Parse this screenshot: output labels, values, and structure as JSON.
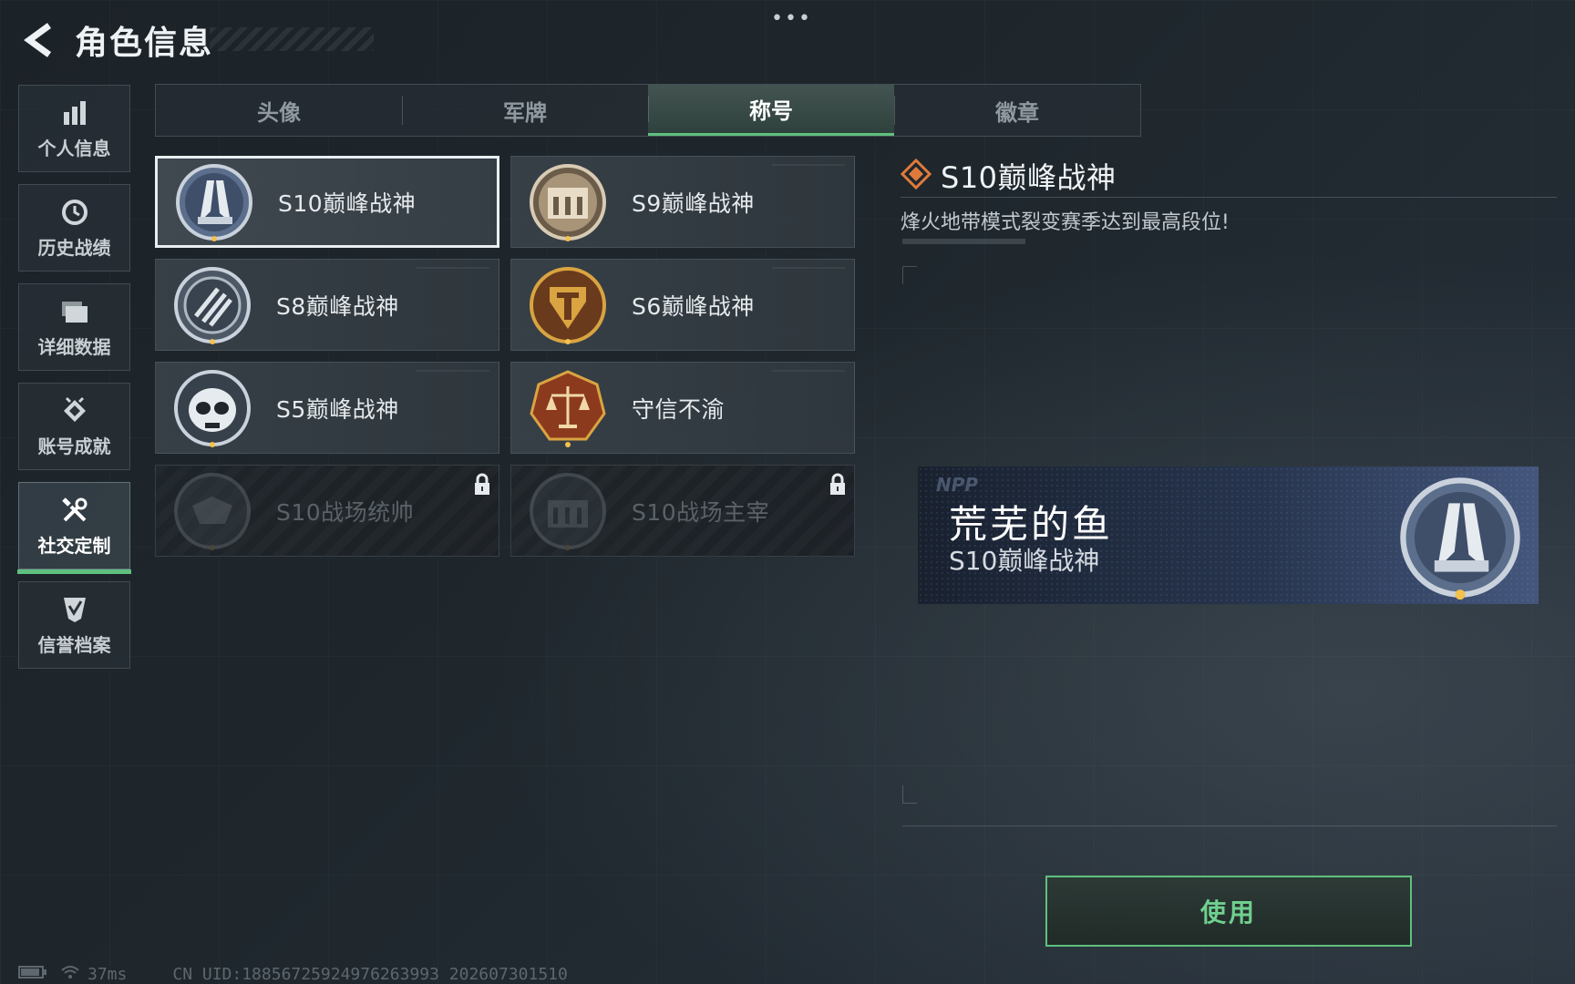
{
  "header": {
    "title": "角色信息",
    "more_label": "•••"
  },
  "sidebar": {
    "items": [
      {
        "label": "个人信息",
        "icon": "bar-chart-icon"
      },
      {
        "label": "历史战绩",
        "icon": "history-icon"
      },
      {
        "label": "详细数据",
        "icon": "folder-icon"
      },
      {
        "label": "账号成就",
        "icon": "achievement-icon"
      },
      {
        "label": "社交定制",
        "icon": "tools-icon",
        "active": true
      },
      {
        "label": "信誉档案",
        "icon": "shield-check-icon"
      }
    ]
  },
  "tabs": [
    {
      "label": "头像"
    },
    {
      "label": "军牌"
    },
    {
      "label": "称号",
      "active": true
    },
    {
      "label": "徽章"
    }
  ],
  "titles": [
    {
      "label": "S10巅峰战神",
      "emblem": "s10-peak-emblem",
      "selected": true,
      "locked": false
    },
    {
      "label": "S9巅峰战神",
      "emblem": "s9-peak-emblem",
      "selected": false,
      "locked": false
    },
    {
      "label": "S8巅峰战神",
      "emblem": "s8-peak-emblem",
      "selected": false,
      "locked": false
    },
    {
      "label": "S6巅峰战神",
      "emblem": "s6-peak-emblem",
      "selected": false,
      "locked": false
    },
    {
      "label": "S5巅峰战神",
      "emblem": "s5-peak-emblem",
      "selected": false,
      "locked": false
    },
    {
      "label": "守信不渝",
      "emblem": "scales-emblem",
      "selected": false,
      "locked": false
    },
    {
      "label": "S10战场统帅",
      "emblem": "s10-commander-emblem",
      "selected": false,
      "locked": true
    },
    {
      "label": "S10战场主宰",
      "emblem": "s10-dominator-emblem",
      "selected": false,
      "locked": true
    }
  ],
  "detail": {
    "title": "S10巅峰战神",
    "description": "烽火地带模式裂变赛季达到最高段位!"
  },
  "preview": {
    "watermark": "NPP",
    "player_name": "荒芜的鱼",
    "title": "S10巅峰战神"
  },
  "actions": {
    "use_label": "使用"
  },
  "status": {
    "ping": "37ms",
    "uid": "CN UID:18856725924976263993 202607301510"
  },
  "colors": {
    "accent_green": "#5fc07e",
    "detail_diamond": "#e07a3a",
    "preview_blue": "#3a4e78"
  }
}
